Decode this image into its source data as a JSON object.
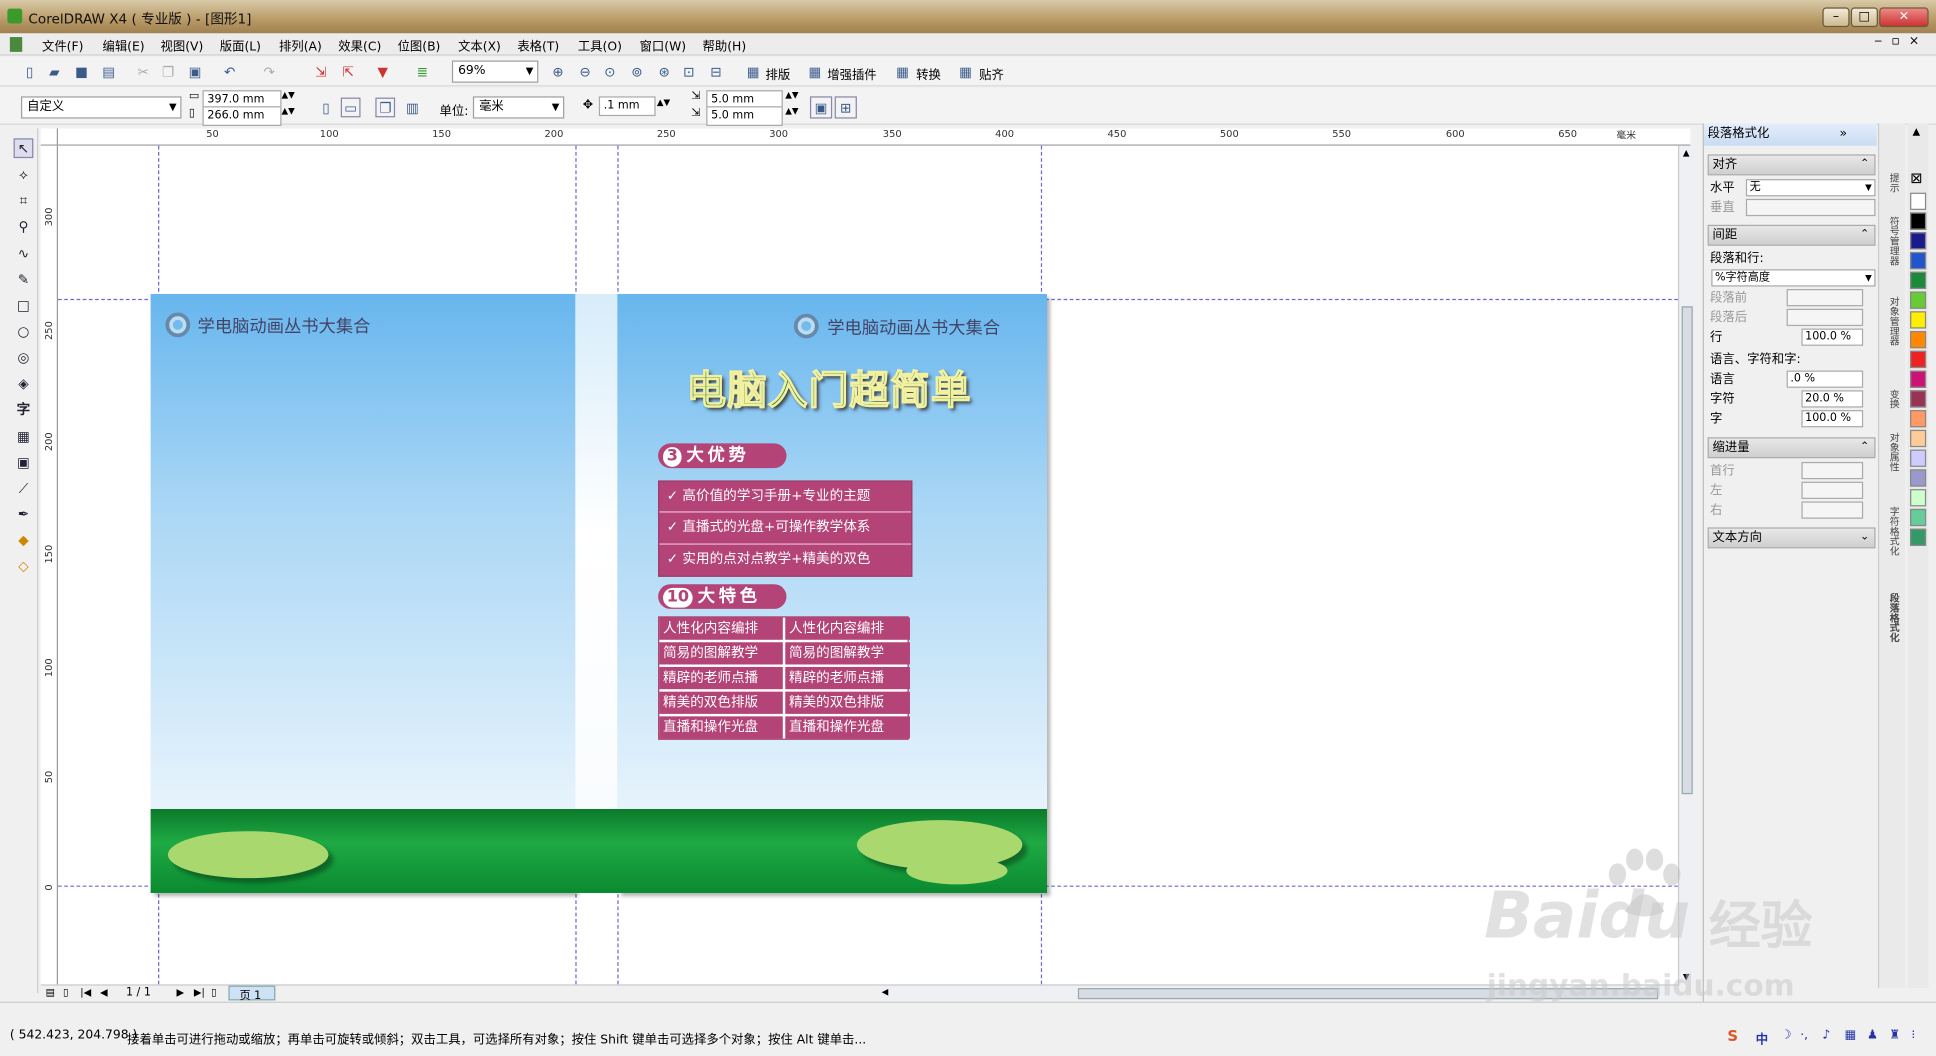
{
  "window": {
    "title": "CorelDRAW X4 ( 专业版 ) - [图形1]",
    "min": "–",
    "max": "□",
    "close": "✕"
  },
  "menu": [
    "文件(F)",
    "编辑(E)",
    "视图(V)",
    "版面(L)",
    "排列(A)",
    "效果(C)",
    "位图(B)",
    "文本(X)",
    "表格(T)",
    "工具(O)",
    "窗口(W)",
    "帮助(H)"
  ],
  "toolbar": {
    "zoom": "69%",
    "plugins": [
      "排版",
      "增强插件",
      "转换",
      "贴齐"
    ]
  },
  "propbar": {
    "preset": "自定义",
    "width": "397.0 mm",
    "height": "266.0 mm",
    "unit_label": "单位:",
    "unit": "毫米",
    "nudge": ".1 mm",
    "dup_x": "5.0 mm",
    "dup_y": "5.0 mm"
  },
  "ruler": {
    "h_ticks": [
      "50",
      "100",
      "150",
      "200",
      "250",
      "300",
      "350",
      "400",
      "450",
      "500",
      "550",
      "600",
      "650"
    ],
    "v_ticks": [
      "300",
      "250",
      "200",
      "150",
      "100",
      "50",
      "0"
    ],
    "unit": "毫米"
  },
  "design": {
    "series": "学电脑动画丛书大集合",
    "main_title": "电脑入门超简单",
    "advantages_num": "3",
    "advantages_title": "大优势",
    "advantages": [
      "✓  高价值的学习手册+专业的主题",
      "✓  直播式的光盘+可操作教学体系",
      "✓  实用的点对点教学+精美的双色"
    ],
    "features_num": "10",
    "features_title": "大特色",
    "features": [
      [
        "人性化内容编排",
        "人性化内容编排"
      ],
      [
        "简易的图解教学",
        "简易的图解教学"
      ],
      [
        "精辟的老师点播",
        "精辟的老师点播"
      ],
      [
        "精美的双色排版",
        "精美的双色排版"
      ],
      [
        "直播和操作光盘",
        "直播和操作光盘"
      ]
    ]
  },
  "pagenav": {
    "counter": "1 / 1",
    "tab": "页 1"
  },
  "docker": {
    "title": "段落格式化",
    "align_section": "对齐",
    "horizontal_label": "水平",
    "horizontal_value": "无",
    "vertical_label": "垂直",
    "spacing_section": "间距",
    "para_line_label": "段落和行:",
    "para_line_value": "%字符高度",
    "before_label": "段落前",
    "after_label": "段落后",
    "line_label": "行",
    "line_value": "100.0 %",
    "lang_label": "语言、字符和字:",
    "language_label": "语言",
    "language_value": ".0 %",
    "char_label": "字符",
    "char_value": "20.0 %",
    "word_label": "字",
    "word_value": "100.0 %",
    "indent_section": "缩进量",
    "first_label": "首行",
    "left_label": "左",
    "right_label": "右",
    "textdir_section": "文本方向"
  },
  "dock_tabs": [
    "提示",
    "符号管理器",
    "对象管理器",
    "变换",
    "对象属性",
    "字符格式化",
    "段落格式化"
  ],
  "palette_colors": [
    "#ffffff",
    "#000000",
    "#1a1a8a",
    "#2255cc",
    "#1b8a3a",
    "#66cc33",
    "#ffee00",
    "#ff8800",
    "#ee2222",
    "#cc1177",
    "#993355",
    "#ff9966",
    "#ffcc99",
    "#ccccff",
    "#9999cc",
    "#ccffcc",
    "#66cc99",
    "#339966"
  ],
  "status": {
    "coords": "( 542.423, 204.798 )",
    "hint": "接着单击可进行拖动或缩放；再单击可旋转或倾斜；双击工具，可选择所有对象；按住 Shift 键单击可选择多个对象；按住 Alt 键单击..."
  },
  "watermark": {
    "logo": "Bai",
    "logo2": "du",
    "cn": "经验",
    "url": "jingyan.baidu.com"
  }
}
